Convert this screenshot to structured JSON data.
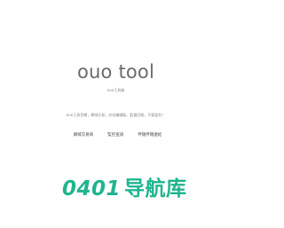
{
  "header": {
    "title": "ouo tool",
    "subtitle": "ouo工具箱"
  },
  "description": "ouo工具官網，網域交易，炒站賺錢點，監督回報，不要盈利！",
  "nav": {
    "items": [
      {
        "label": "網域交易商"
      },
      {
        "label": "監控查詢"
      },
      {
        "label": "伴隨伴隨連結"
      }
    ]
  },
  "watermark": {
    "digits": "0401",
    "text": "导航库",
    "color": "#1fb58f"
  }
}
